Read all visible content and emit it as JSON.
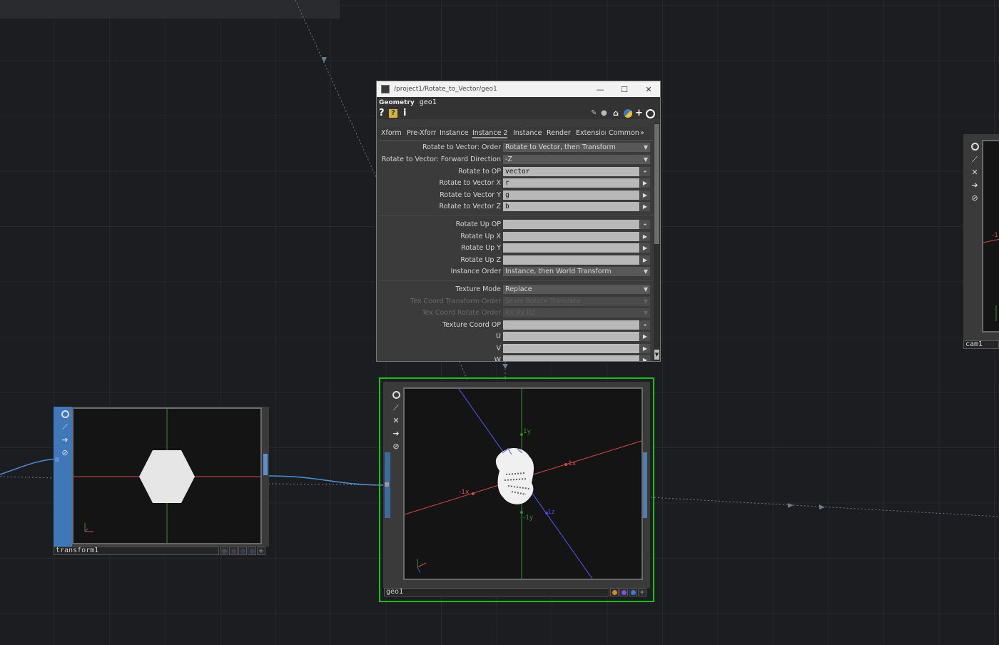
{
  "window": {
    "title_path": "/project1/Rotate_to_Vector/geo1",
    "op_type": "Geometry",
    "op_name": "geo1",
    "minimize_glyph": "—",
    "maximize_glyph": "☐",
    "close_glyph": "✕",
    "help_glyph": "?",
    "python_help_glyph": "?",
    "info_glyph": "i",
    "tabs": [
      "Xform",
      "Pre-Xform",
      "Instance",
      "Instance 2",
      "Instance",
      "Render",
      "Extensions",
      "Common",
      "»"
    ],
    "active_tab": "Instance 2"
  },
  "params": {
    "rtv_order": {
      "label": "Rotate to Vector: Order",
      "value": "Rotate to Vector, then Transform"
    },
    "rtv_forward": {
      "label": "Rotate to Vector: Forward Direction",
      "value": "-Z"
    },
    "rtv_op": {
      "label": "Rotate to OP",
      "value": "vector"
    },
    "rtv_x": {
      "label": "Rotate to Vector X",
      "value": "r"
    },
    "rtv_y": {
      "label": "Rotate to Vector Y",
      "value": "g"
    },
    "rtv_z": {
      "label": "Rotate to Vector Z",
      "value": "b"
    },
    "up_op": {
      "label": "Rotate Up OP",
      "value": ""
    },
    "up_x": {
      "label": "Rotate Up X",
      "value": ""
    },
    "up_y": {
      "label": "Rotate Up Y",
      "value": ""
    },
    "up_z": {
      "label": "Rotate Up Z",
      "value": ""
    },
    "inst_order": {
      "label": "Instance Order",
      "value": "Instance, then World Transform"
    },
    "tex_mode": {
      "label": "Texture Mode",
      "value": "Replace"
    },
    "tex_xform_order": {
      "label": "Tex Coord Transform Order",
      "value": "Scale Rotate Translate"
    },
    "tex_rot_order": {
      "label": "Tex Coord Rotate Order",
      "value": "Rx Ry Rz"
    },
    "tex_op": {
      "label": "Texture Coord OP",
      "value": ""
    },
    "u": {
      "label": "U",
      "value": ""
    },
    "v": {
      "label": "V",
      "value": ""
    },
    "w": {
      "label": "W",
      "value": ""
    }
  },
  "nodes": {
    "transform1": {
      "name": "transform1"
    },
    "geo1": {
      "name": "geo1",
      "axis_labels": {
        "pos_y": "1y",
        "neg_y": "-1y",
        "pos_x": "1x",
        "neg_x": "-1x",
        "pos_z": "1z"
      }
    },
    "cam1": {
      "name": "cam1",
      "axis_label": "-1"
    }
  },
  "colors": {
    "background": "#1c1d21",
    "wire_active": "#4a90d9",
    "selection": "#16c21a",
    "axis_x": "#d34a4a",
    "axis_y": "#2f8f2f",
    "axis_z": "#4a4ad6",
    "flag_orange": "#d08a2a",
    "flag_purple": "#7a55d8",
    "flag_blue": "#3a78d6"
  }
}
